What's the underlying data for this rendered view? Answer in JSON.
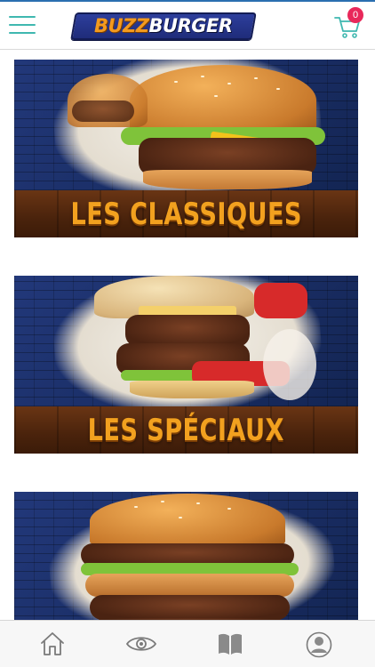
{
  "header": {
    "logo": {
      "part1": "BUZZ",
      "part2": "BURGER"
    },
    "menu_icon": "hamburger-menu-icon",
    "cart": {
      "icon": "shopping-cart-icon",
      "count": "0"
    }
  },
  "categories": [
    {
      "title": "LES CLASSIQUES"
    },
    {
      "title": "LES SPÉCIAUX"
    },
    {
      "title": ""
    }
  ],
  "bottom_nav": [
    {
      "icon": "home-icon"
    },
    {
      "icon": "eye-icon"
    },
    {
      "icon": "book-icon"
    },
    {
      "icon": "user-icon"
    }
  ],
  "colors": {
    "accent_teal": "#3fb8b0",
    "badge_pink": "#e8285a",
    "logo_orange": "#f39a1e",
    "logo_navy": "#1f2c7a",
    "title_orange": "#f2a11f"
  }
}
